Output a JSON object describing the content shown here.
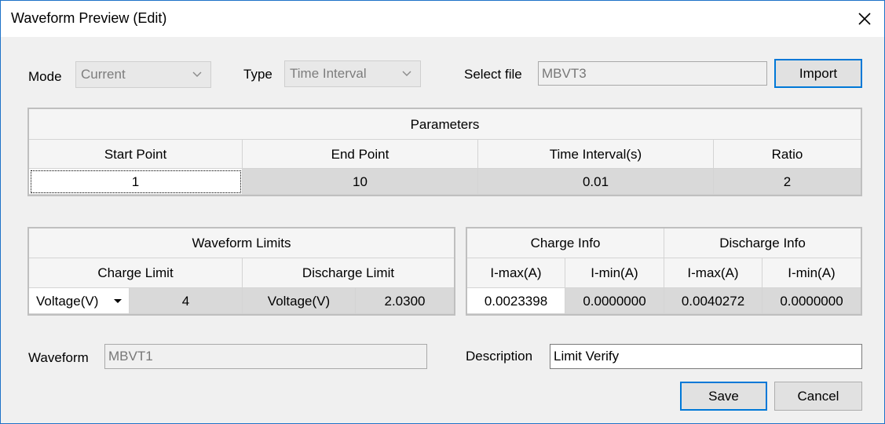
{
  "window": {
    "title": "Waveform Preview (Edit)",
    "close_icon": "close-icon"
  },
  "top": {
    "mode_label": "Mode",
    "mode_value": "Current",
    "type_label": "Type",
    "type_value": "Time Interval",
    "select_file_label": "Select file",
    "select_file_value": "MBVT3",
    "import_label": "Import"
  },
  "parameters": {
    "title": "Parameters",
    "columns": [
      "Start Point",
      "End Point",
      "Time Interval(s)",
      "Ratio"
    ],
    "values": [
      "1",
      "10",
      "0.01",
      "2"
    ]
  },
  "limits": {
    "title": "Waveform Limits",
    "charge_limit": "Charge Limit",
    "discharge_limit": "Discharge Limit",
    "charge_type": "Voltage(V)",
    "charge_value": "4",
    "discharge_type": "Voltage(V)",
    "discharge_value": "2.0300"
  },
  "info": {
    "charge_title": "Charge Info",
    "discharge_title": "Discharge Info",
    "columns": [
      "I-max(A)",
      "I-min(A)",
      "I-max(A)",
      "I-min(A)"
    ],
    "values": [
      "0.0023398",
      "0.0000000",
      "0.0040272",
      "0.0000000"
    ]
  },
  "bottom": {
    "waveform_label": "Waveform",
    "waveform_value": "MBVT1",
    "description_label": "Description",
    "description_value": "Limit Verify",
    "save_label": "Save",
    "cancel_label": "Cancel"
  }
}
